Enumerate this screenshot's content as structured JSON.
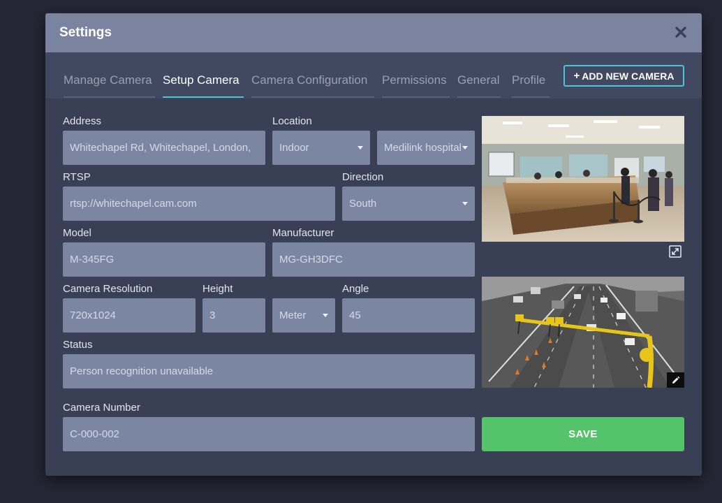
{
  "modal": {
    "title": "Settings",
    "close_icon": "close-icon"
  },
  "tabs": [
    {
      "label": "Manage Camera",
      "active": false
    },
    {
      "label": "Setup Camera",
      "active": true
    },
    {
      "label": "Camera Configuration",
      "active": false
    },
    {
      "label": "Permissions",
      "active": false
    },
    {
      "label": "General",
      "active": false
    },
    {
      "label": "Profile",
      "active": false
    }
  ],
  "add_camera_button": {
    "icon": "plus-icon",
    "label": "ADD NEW CAMERA"
  },
  "form": {
    "address": {
      "label": "Address",
      "value": "Whitechapel Rd, Whitechapel, London,"
    },
    "location": {
      "label": "Location",
      "type_value": "Indoor",
      "place_value": "Medilink hospital"
    },
    "rtsp": {
      "label": "RTSP",
      "value": "rtsp://whitechapel.cam.com"
    },
    "direction": {
      "label": "Direction",
      "value": "South"
    },
    "model": {
      "label": "Model",
      "value": "M-345FG"
    },
    "manufacturer": {
      "label": "Manufacturer",
      "value": "MG-GH3DFC"
    },
    "resolution": {
      "label": "Camera Resolution",
      "value": "720x1024"
    },
    "height": {
      "label": "Height",
      "value": "3",
      "unit": "Meter"
    },
    "angle": {
      "label": "Angle",
      "value": "45"
    },
    "status": {
      "label": "Status",
      "value": "Person recognition unavailable"
    },
    "camera_number": {
      "label": "Camera Number",
      "value": "C-000-002"
    }
  },
  "save_button": {
    "label": "SAVE"
  },
  "images": {
    "preview_top": {
      "icon": "expand-icon"
    },
    "preview_bottom": {
      "icon": "edit-pencil-icon"
    }
  },
  "colors": {
    "background": "#262636",
    "modal_body": "#394055",
    "modal_header": "#7a84a1",
    "field": "#7b86a3",
    "accent": "#4cc4dc",
    "save": "#55c36a"
  }
}
